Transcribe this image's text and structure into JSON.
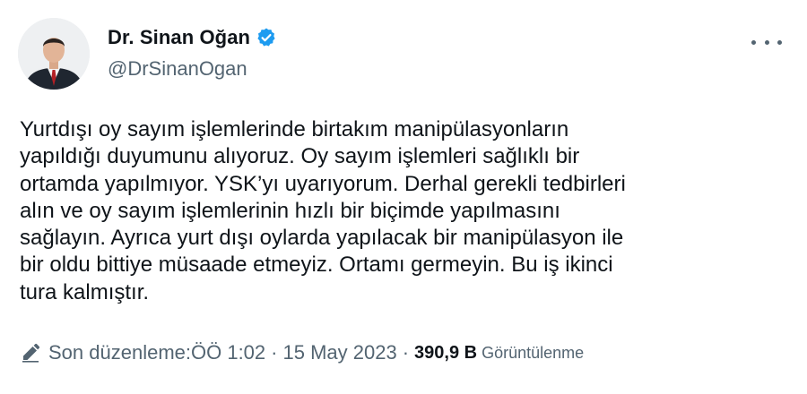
{
  "author": {
    "display_name": "Dr. Sinan Oğan",
    "handle": "@DrSinanOgan",
    "verified": true
  },
  "tweet": {
    "text": "Yurtdışı oy sayım işlemlerinde birtakım manipülasyonların\nyapıldığı duyumunu alıyoruz. Oy sayım işlemleri sağlıklı bir\nortamda yapılmıyor. YSK’yı uyarıyorum. Derhal gerekli tedbirleri\nalın ve oy sayım işlemlerinin hızlı bir biçimde yapılmasını\nsağlayın. Ayrıca yurt dışı oylarda yapılacak bir manipülasyon ile\nbir oldu bittiye müsaade etmeyiz. Ortamı germeyin. Bu iş ikinci\ntura kalmıştır."
  },
  "meta": {
    "edited_label": "Son düzenleme:",
    "time": "ÖÖ 1:02",
    "separator1": "·",
    "date": "15 May 2023",
    "separator2": "·",
    "views_count": "390,9 B",
    "views_label": "Görüntülenme"
  },
  "icons": {
    "verified": "verified-badge-icon",
    "more": "more-options-icon",
    "edit": "pencil-edit-icon"
  },
  "colors": {
    "text_primary": "#0f1419",
    "text_secondary": "#536471",
    "verified_blue": "#1d9bf0"
  }
}
